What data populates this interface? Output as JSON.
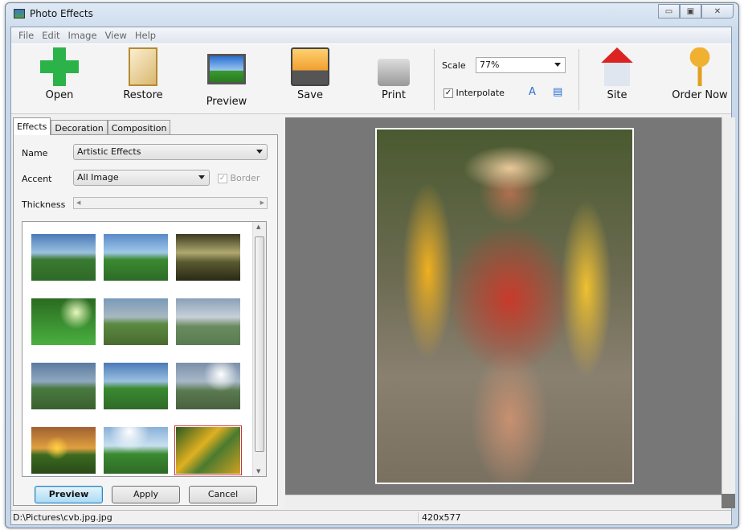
{
  "window": {
    "title": "Photo Effects"
  },
  "menu": [
    "File",
    "Edit",
    "Image",
    "View",
    "Help"
  ],
  "toolbar": {
    "open": "Open",
    "restore": "Restore",
    "preview": "Preview",
    "save": "Save",
    "print": "Print",
    "scale_label": "Scale",
    "scale_value": "77%",
    "interpolate_label": "Interpolate",
    "interpolate_checked": true,
    "site": "Site",
    "order": "Order Now"
  },
  "tabs": [
    "Effects",
    "Decoration",
    "Composition"
  ],
  "effects": {
    "name_label": "Name",
    "name_value": "Artistic Effects",
    "accent_label": "Accent",
    "accent_value": "All Image",
    "border_label": "Border",
    "border_checked": true,
    "thickness_label": "Thickness",
    "selected_thumbnail": 12
  },
  "buttons": {
    "preview": "Preview",
    "apply": "Apply",
    "cancel": "Cancel"
  },
  "status": {
    "path": "D:\\Pictures\\cvb.jpg.jpg",
    "size": "420x577"
  }
}
